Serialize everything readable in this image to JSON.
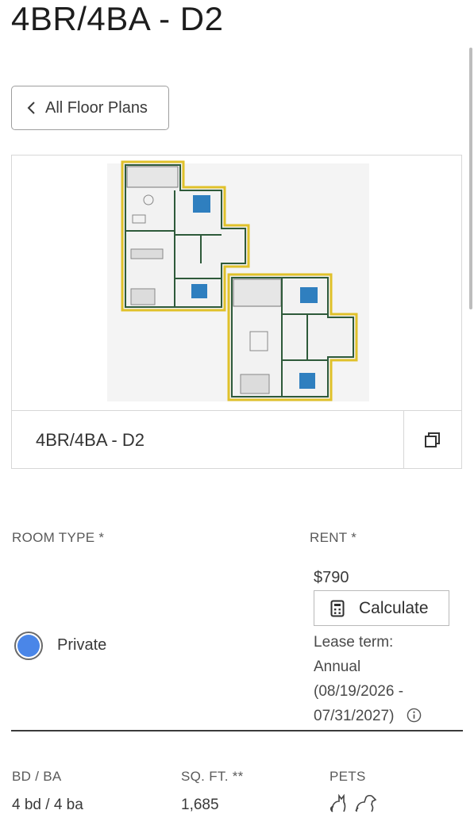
{
  "page": {
    "title": "4BR/4BA - D2"
  },
  "back": {
    "label": "All Floor Plans"
  },
  "plan": {
    "name": "4BR/4BA - D2"
  },
  "room_type": {
    "label": "ROOM TYPE *",
    "option": "Private",
    "selected": true
  },
  "rent": {
    "label": "RENT *",
    "price": "$790",
    "calculate_label": "Calculate",
    "lease_term_label": "Lease term:",
    "lease_term_value": "Annual",
    "lease_dates_line1": "(08/19/2026 -",
    "lease_dates_line2": "07/31/2027)"
  },
  "details": {
    "bd_ba_label": "BD / BA",
    "bd_ba_value": "4 bd / 4 ba",
    "sqft_label": "SQ. FT. **",
    "sqft_value": "1,685",
    "pets_label": "PETS",
    "pets_icons": [
      "cat-icon",
      "dog-icon"
    ]
  },
  "colors": {
    "accent": "#4a86e8",
    "plan_outline": "#e0c12a",
    "plan_walls": "#2e5a3a",
    "plan_beds": "#2f7fbf"
  }
}
